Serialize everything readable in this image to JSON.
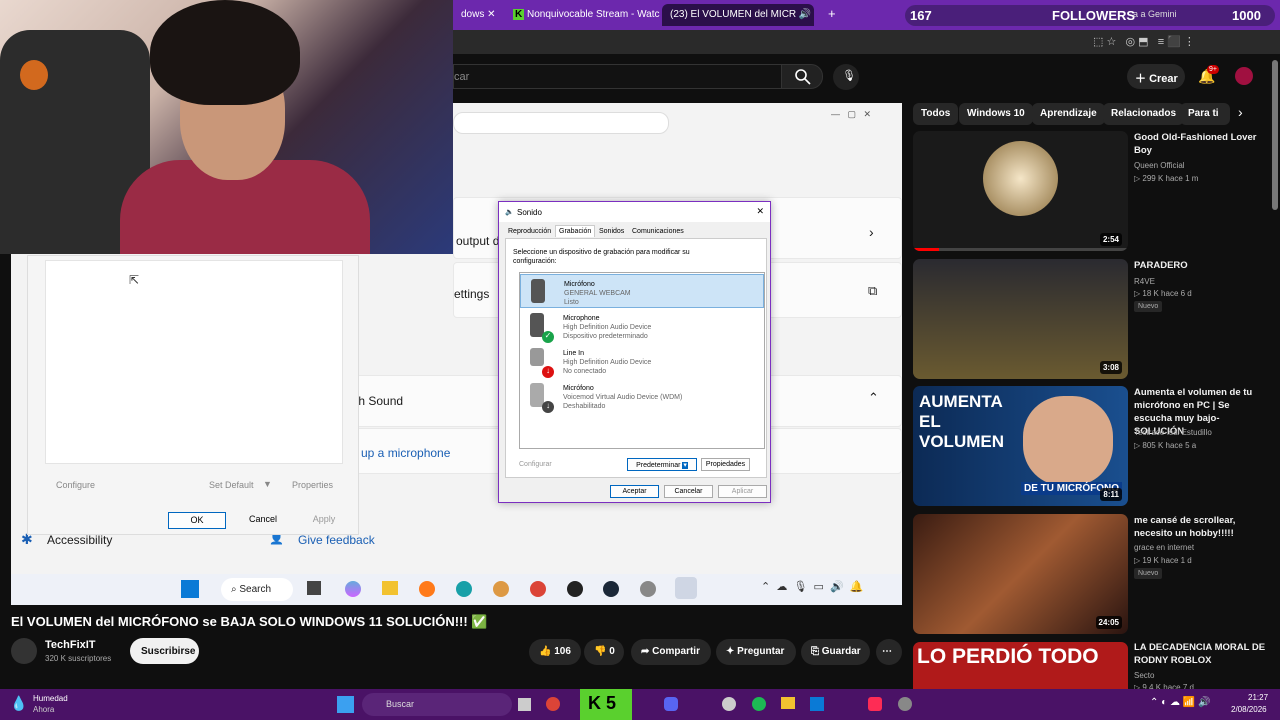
{
  "browser": {
    "tabs": [
      {
        "label": "dows"
      },
      {
        "label": "Nonquivocable Stream - Watch"
      },
      {
        "label": "(23) El VOLUMEN del MICR"
      }
    ],
    "new_tab": "+",
    "followers_left": "167",
    "followers_label": "FOLLOWERS",
    "followers_right": "1000",
    "gemini_text": "a a Gemini"
  },
  "youtube": {
    "search_placeholder": "car",
    "create_label": "Crear",
    "notif_count": "9+",
    "chips": [
      "Todos",
      "Windows 10",
      "Aprendizaje",
      "Relacionados",
      "Para ti"
    ],
    "video_title": "El VOLUMEN del MICRÓFONO se BAJA SOLO WINDOWS 11 SOLUCIÓN!!! ✅",
    "channel_name": "TechFixIT",
    "subscribers": "320 K suscriptores",
    "subscribe": "Suscribirse",
    "likes": "106",
    "dislikes": "0",
    "share": "Compartir",
    "ask": "Preguntar",
    "save": "Guardar",
    "related": [
      {
        "title": "Good Old-Fashioned Lover Boy",
        "channel": "Queen Official",
        "meta": "▷ 299 K  hace 1 m",
        "duration": "2:54",
        "badge": ""
      },
      {
        "title": "PARADERO",
        "channel": "R4VE",
        "meta": "▷ 18 K  hace 6 d",
        "duration": "3:08",
        "badge": "Nuevo"
      },
      {
        "title": "Aumenta el volumen de tu micrófono en PC | Se escucha muy bajo-SOLUCIÓN",
        "channel": "Tectrace-Isal Estudillo",
        "meta": "▷ 805 K  hace 5 a",
        "duration": "8:11",
        "badge": ""
      },
      {
        "title": "me cansé de scrollear, necesito un hobby!!!!!",
        "channel": "grace en internet",
        "meta": "▷ 19 K  hace 1 d",
        "duration": "24:05",
        "badge": "Nuevo"
      },
      {
        "title": "LA DECADENCIA MORAL DE RODNY ROBLOX",
        "channel": "Secto",
        "meta": "▷ 9,4 K  hace 7 d",
        "duration": "",
        "badge": ""
      }
    ],
    "thumb_text_1": "AUMENTA EL VOLUMEN",
    "thumb_text_2": "DE TU MICRÓFONO",
    "thumb_text_3": "LO PERDIÓ TODO"
  },
  "settings": {
    "output_text": "output d",
    "settings_text": "ettings",
    "sound_text": "th Sound",
    "mic_link": "up a microphone",
    "accessibility": "Accessibility",
    "feedback": "Give feedback"
  },
  "sound_dialog": {
    "title": "Sonido",
    "tabs": [
      "Reproducción",
      "Grabación",
      "Sonidos",
      "Comunicaciones"
    ],
    "instruction": "Seleccione un dispositivo de grabación para modificar su configuración:",
    "devices": [
      {
        "name": "Micrófono",
        "device": "GENERAL WEBCAM",
        "status": "Listo"
      },
      {
        "name": "Microphone",
        "device": "High Definition Audio Device",
        "status": "Dispositivo predeterminado"
      },
      {
        "name": "Line In",
        "device": "High Definition Audio Device",
        "status": "No conectado"
      },
      {
        "name": "Micrófono",
        "device": "Voicemod Virtual Audio Device (WDM)",
        "status": "Deshabilitado"
      }
    ],
    "configure": "Configurar",
    "set_default": "Predeterminar",
    "properties": "Propiedades",
    "ok": "Aceptar",
    "cancel": "Cancelar",
    "apply": "Aplicar"
  },
  "mic_dialog": {
    "configure": "Configure",
    "set_default": "Set Default",
    "properties": "Properties",
    "ok": "OK",
    "cancel": "Cancel",
    "apply": "Apply"
  },
  "inner_taskbar": {
    "search": "Search"
  },
  "taskbar": {
    "weather_title": "Humedad",
    "weather_sub": "Ahora",
    "search": "Buscar",
    "time": "21:27",
    "date": "2/08/2026"
  }
}
